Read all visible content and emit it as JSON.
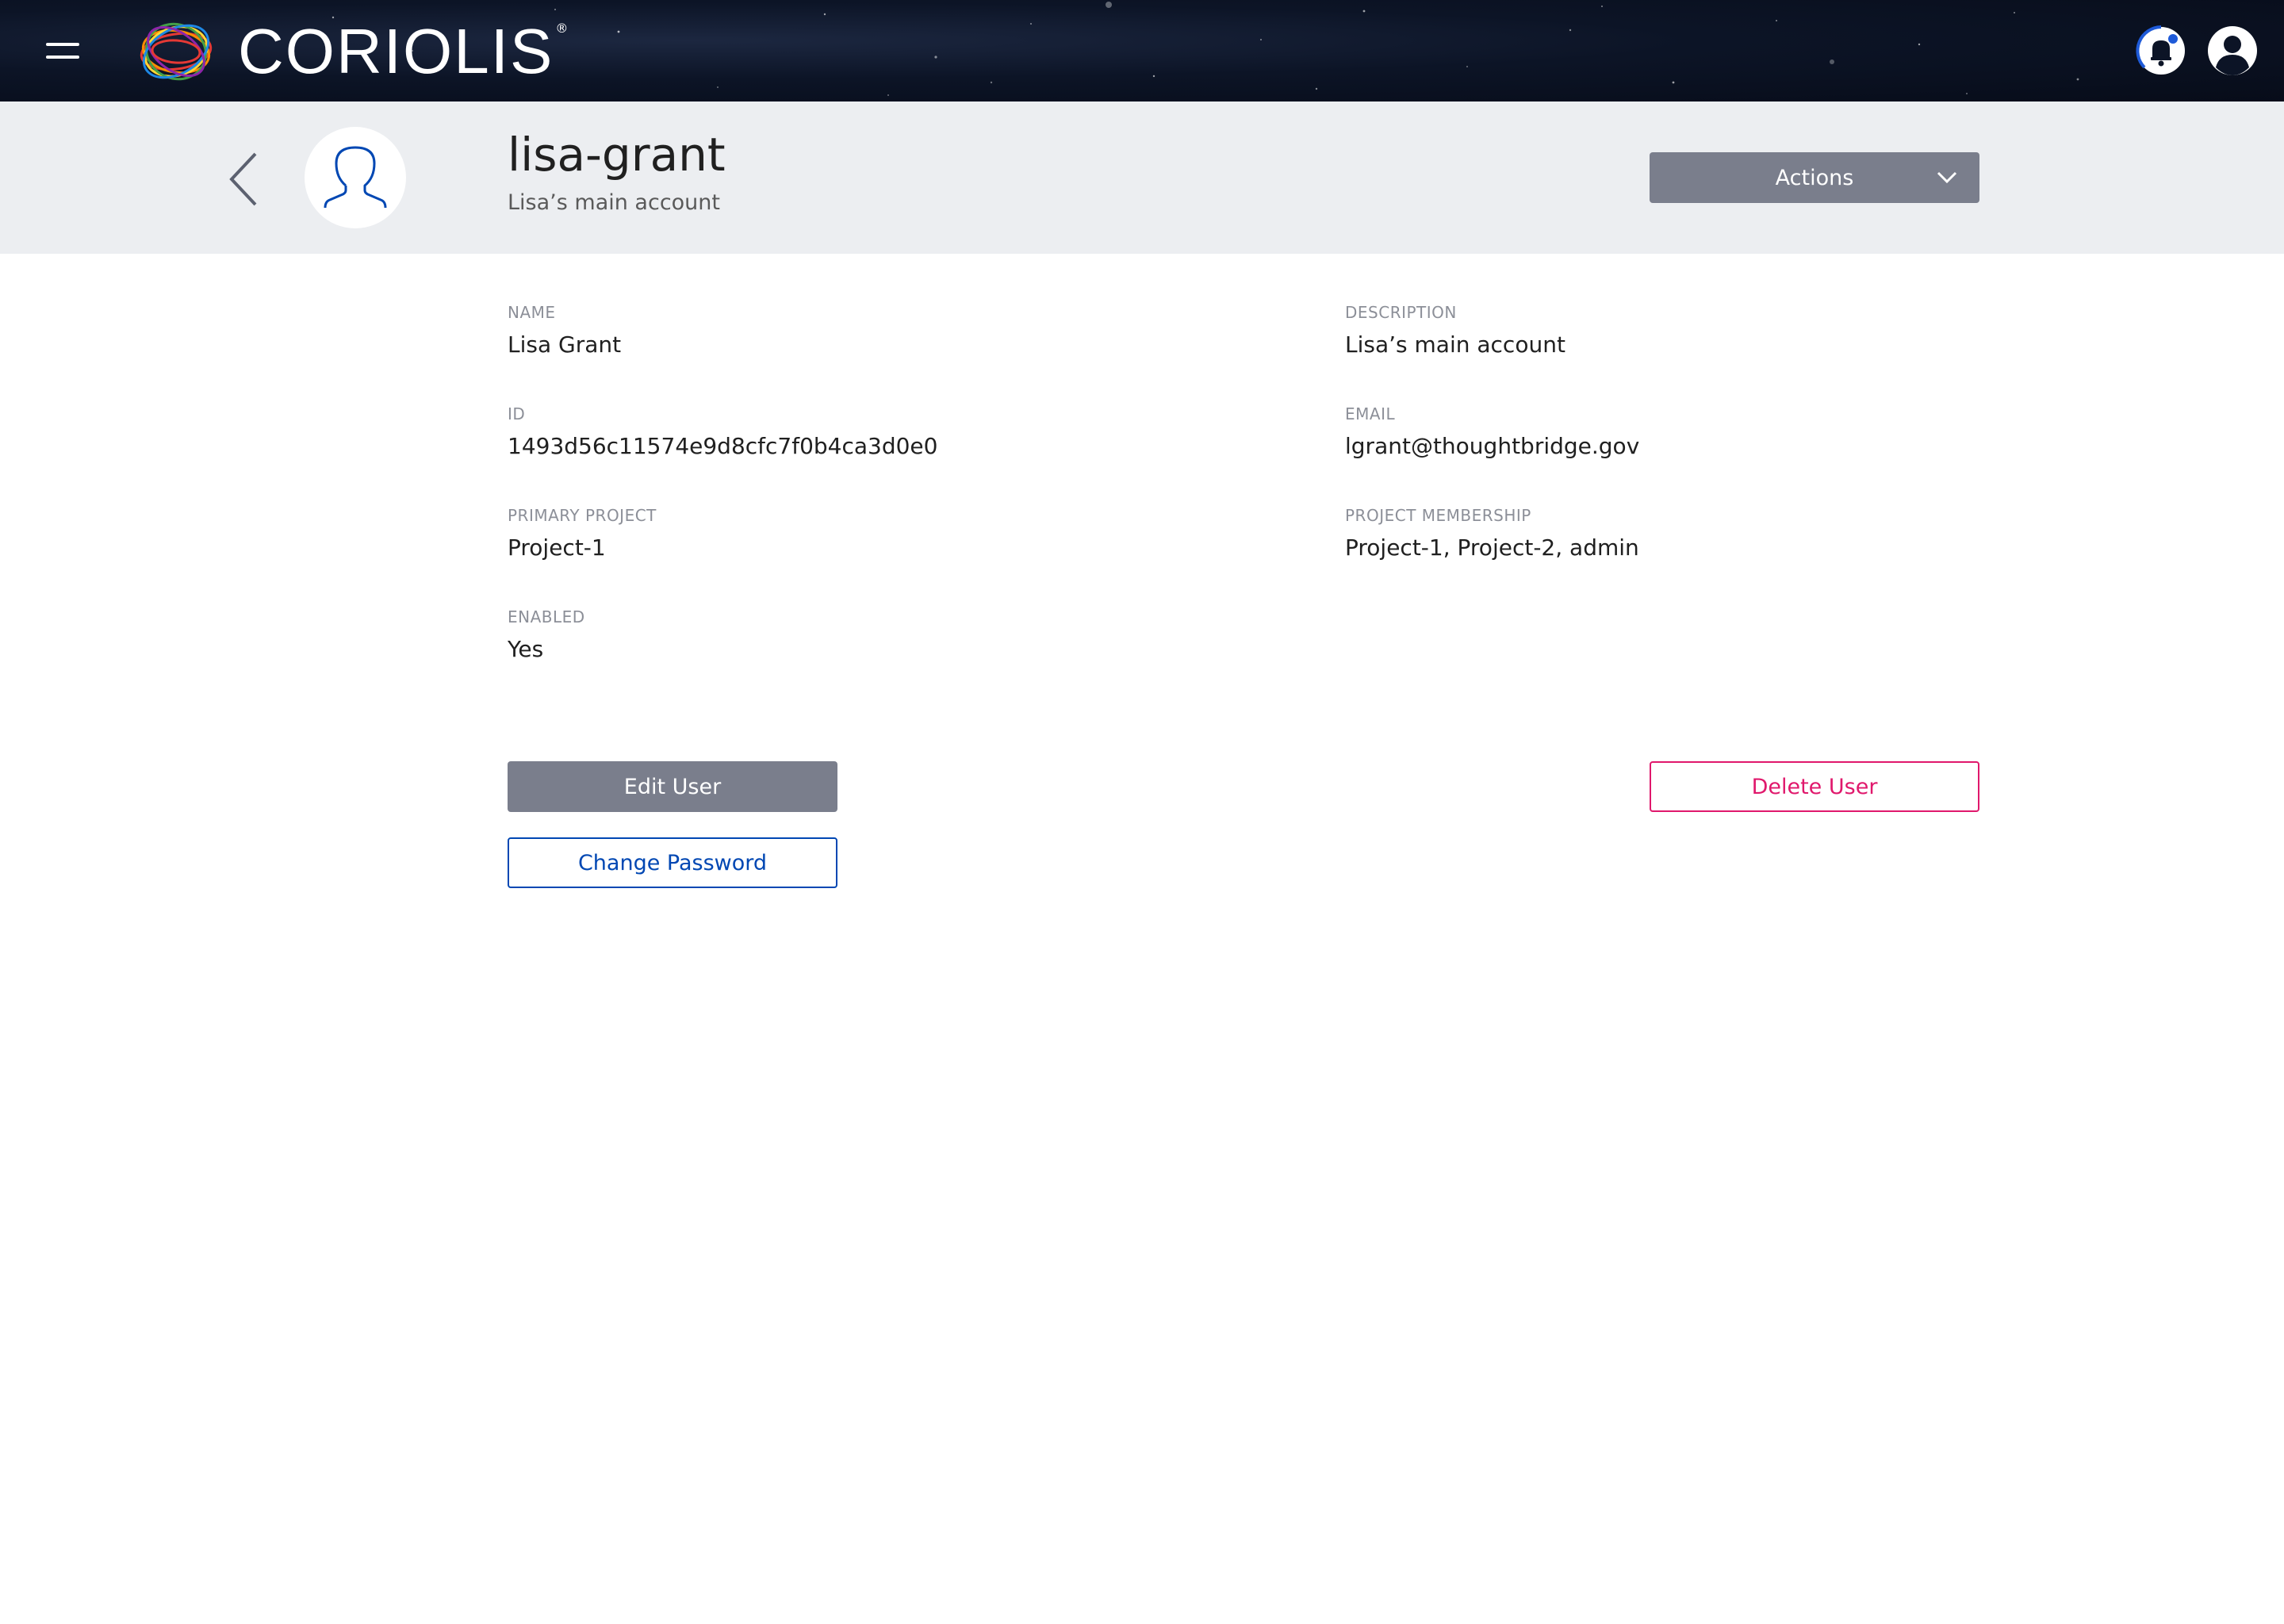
{
  "navbar": {
    "brand": "CORIOLIS",
    "brand_mark": "®",
    "menu_icon": "hamburger-menu-icon",
    "notification_icon": "bell-icon",
    "user_icon": "user-avatar-icon"
  },
  "header": {
    "back_icon": "chevron-left-icon",
    "avatar_icon": "user-silhouette-icon",
    "title": "lisa-grant",
    "subtitle": "Lisa’s main account",
    "actions_label": "Actions",
    "actions_icon": "chevron-down-icon"
  },
  "info": {
    "name_label": "NAME",
    "name_value": "Lisa Grant",
    "description_label": "DESCRIPTION",
    "description_value": "Lisa’s main account",
    "id_label": "ID",
    "id_value": "1493d56c11574e9d8cfc7f0b4ca3d0e0",
    "email_label": "EMAIL",
    "email_value": "lgrant@thoughtbridge.gov",
    "primary_project_label": "PRIMARY PROJECT",
    "primary_project_value": "Project-1",
    "project_membership_label": "PROJECT MEMBERSHIP",
    "project_membership_value": "Project-1, Project-2, admin",
    "enabled_label": "ENABLED",
    "enabled_value": "Yes"
  },
  "buttons": {
    "edit_user": "Edit User",
    "change_password": "Change Password",
    "delete_user": "Delete User"
  },
  "colors": {
    "navbar_bg": "#0c1426",
    "header_bg": "#eceef1",
    "primary_gray": "#7a7e8c",
    "link_blue": "#0047b3",
    "danger_pink": "#e0186c",
    "label_gray": "#8c8f98"
  }
}
